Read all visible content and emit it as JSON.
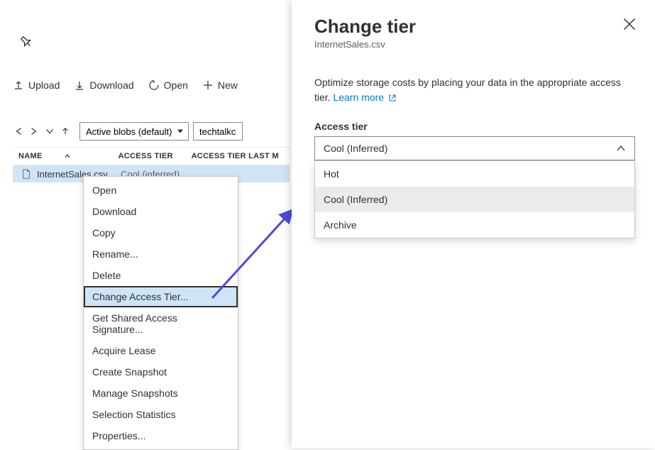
{
  "toolbar": {
    "upload": "Upload",
    "download": "Download",
    "open": "Open",
    "new": "New"
  },
  "nav": {
    "filter": "Active blobs (default)",
    "breadcrumb": "techtalkco"
  },
  "table": {
    "headers": {
      "name": "NAME",
      "tier": "ACCESS TIER",
      "modified": "ACCESS TIER LAST M"
    },
    "rows": [
      {
        "name": "InternetSales.csv",
        "tier": "Cool (inferred)"
      }
    ]
  },
  "context_menu": {
    "items": [
      "Open",
      "Download",
      "Copy",
      "Rename...",
      "Delete",
      "Change Access Tier...",
      "Get Shared Access Signature...",
      "Acquire Lease",
      "Create Snapshot",
      "Manage Snapshots",
      "Selection Statistics",
      "Properties..."
    ],
    "highlighted_index": 5
  },
  "panel": {
    "title": "Change tier",
    "subtitle": "InternetSales.csv",
    "body": "Optimize storage costs by placing your data in the appropriate access tier. ",
    "learn_more": "Learn more",
    "field_label": "Access tier",
    "selected": "Cool (Inferred)",
    "options": [
      "Hot",
      "Cool (Inferred)",
      "Archive"
    ],
    "selected_index": 1
  }
}
